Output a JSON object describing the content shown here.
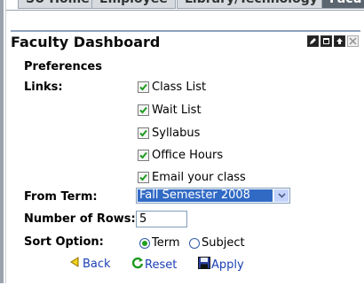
{
  "tabs": [
    {
      "label": "SU Home",
      "active": false
    },
    {
      "label": "Employee",
      "active": false
    },
    {
      "label": "Library/Technology",
      "active": false
    },
    {
      "label": "Facu",
      "active": true
    }
  ],
  "portlet": {
    "title": "Faculty Dashboard",
    "controls": [
      "edit-icon",
      "maximize-icon",
      "restore-icon",
      "close-icon"
    ]
  },
  "form": {
    "preferences_label": "Preferences",
    "links_label": "Links:",
    "links": [
      {
        "label": "Class List",
        "checked": true
      },
      {
        "label": "Wait List",
        "checked": true
      },
      {
        "label": "Syllabus",
        "checked": true
      },
      {
        "label": "Office Hours",
        "checked": true
      },
      {
        "label": "Email your class",
        "checked": true
      }
    ],
    "from_term_label": "From Term:",
    "from_term_value": "Fall Semester 2008",
    "rows_label": "Number of Rows:",
    "rows_value": "5",
    "sort_label": "Sort Option:",
    "sort_options": [
      {
        "label": "Term",
        "selected": true
      },
      {
        "label": "Subject",
        "selected": false
      }
    ]
  },
  "actions": {
    "back": "Back",
    "reset": "Reset",
    "apply": "Apply"
  },
  "colors": {
    "accent": "#316ac5",
    "link": "#1a3fb5",
    "portlet_border": "#8ea2bd"
  }
}
